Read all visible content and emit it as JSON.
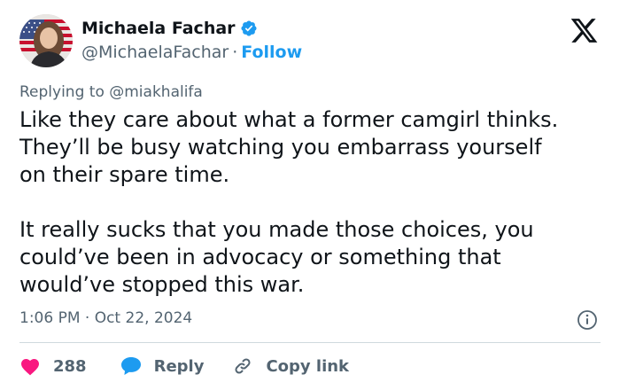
{
  "author": {
    "name": "Michaela Fachar",
    "handle": "@MichaelaFachar",
    "separator": "·",
    "follow_label": "Follow",
    "verified_icon": "verified-badge-icon",
    "avatar_icon": "avatar-photo"
  },
  "brand": {
    "logo_icon": "x-logo-icon"
  },
  "tweet": {
    "reply_context": "Replying to @miakhalifa",
    "paragraphs": [
      "Like they care about what a former camgirl thinks.\nThey’ll be busy watching you embarrass yourself\non their spare time.",
      "It really sucks that you made those choices, you\ncould’ve been in advocacy or something that\nwould’ve stopped this war."
    ],
    "timestamp": "1:06 PM · Oct 22, 2024",
    "info_icon": "info-icon"
  },
  "actions": {
    "like_count": "288",
    "reply_label": "Reply",
    "copy_link_label": "Copy link"
  },
  "colors": {
    "accent": "#1d9bf0",
    "heart": "#f91880",
    "text": "#0f1419",
    "muted": "#536471",
    "divider": "#cfd9de"
  }
}
